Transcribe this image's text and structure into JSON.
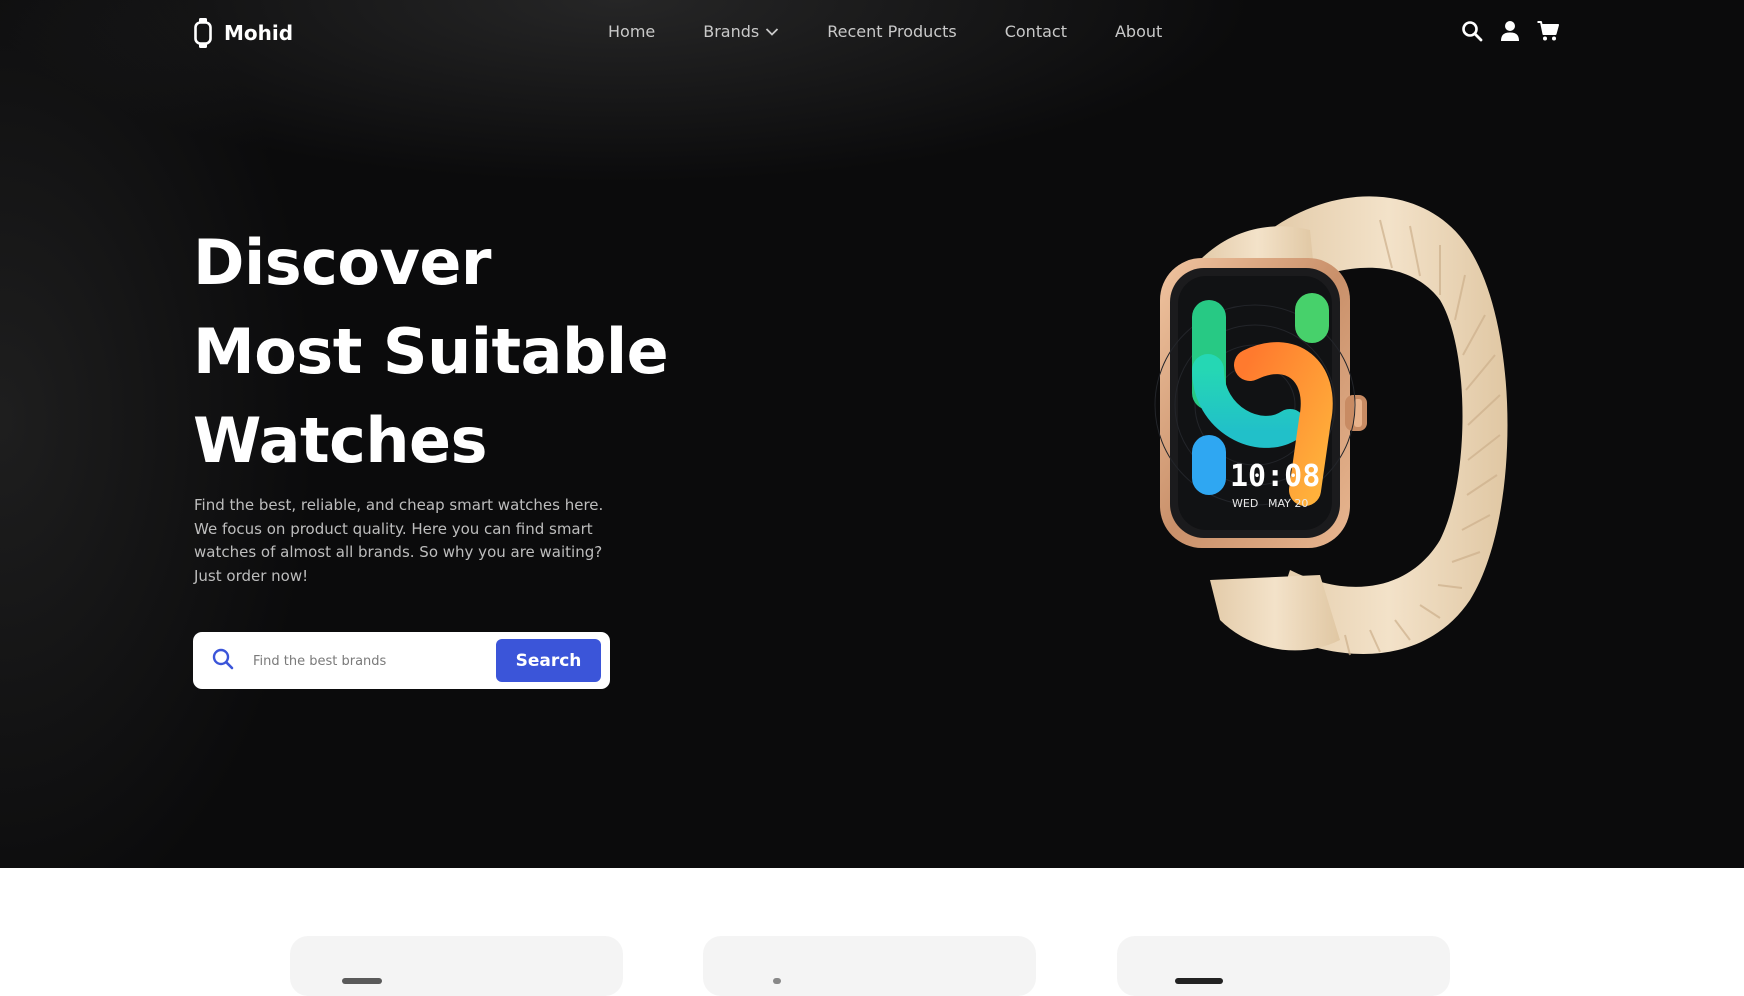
{
  "brand": {
    "name": "Mohid",
    "icon": "watch-icon"
  },
  "nav": {
    "items": [
      {
        "label": "Home"
      },
      {
        "label": "Brands",
        "has_dropdown": true
      },
      {
        "label": "Recent Products"
      },
      {
        "label": "Contact"
      },
      {
        "label": "About"
      }
    ],
    "icons": [
      "search-icon",
      "user-icon",
      "cart-icon"
    ]
  },
  "hero": {
    "headline": [
      "Discover",
      "Most Suitable",
      "Watches"
    ],
    "description": "Find the best, reliable, and cheap smart watches here. We focus on product quality. Here you can find smart watches of almost all brands. So why you are waiting? Just order now!",
    "search": {
      "placeholder": "Find the best brands",
      "value": "",
      "button_label": "Search"
    },
    "watch_display": {
      "time": "10:08",
      "day": "WED",
      "date": "MAY 20"
    }
  },
  "colors": {
    "accent": "#3b55d9",
    "hero_bg": "#0b0b0c",
    "band": "#efdcc2",
    "case": "#d9a37f"
  }
}
